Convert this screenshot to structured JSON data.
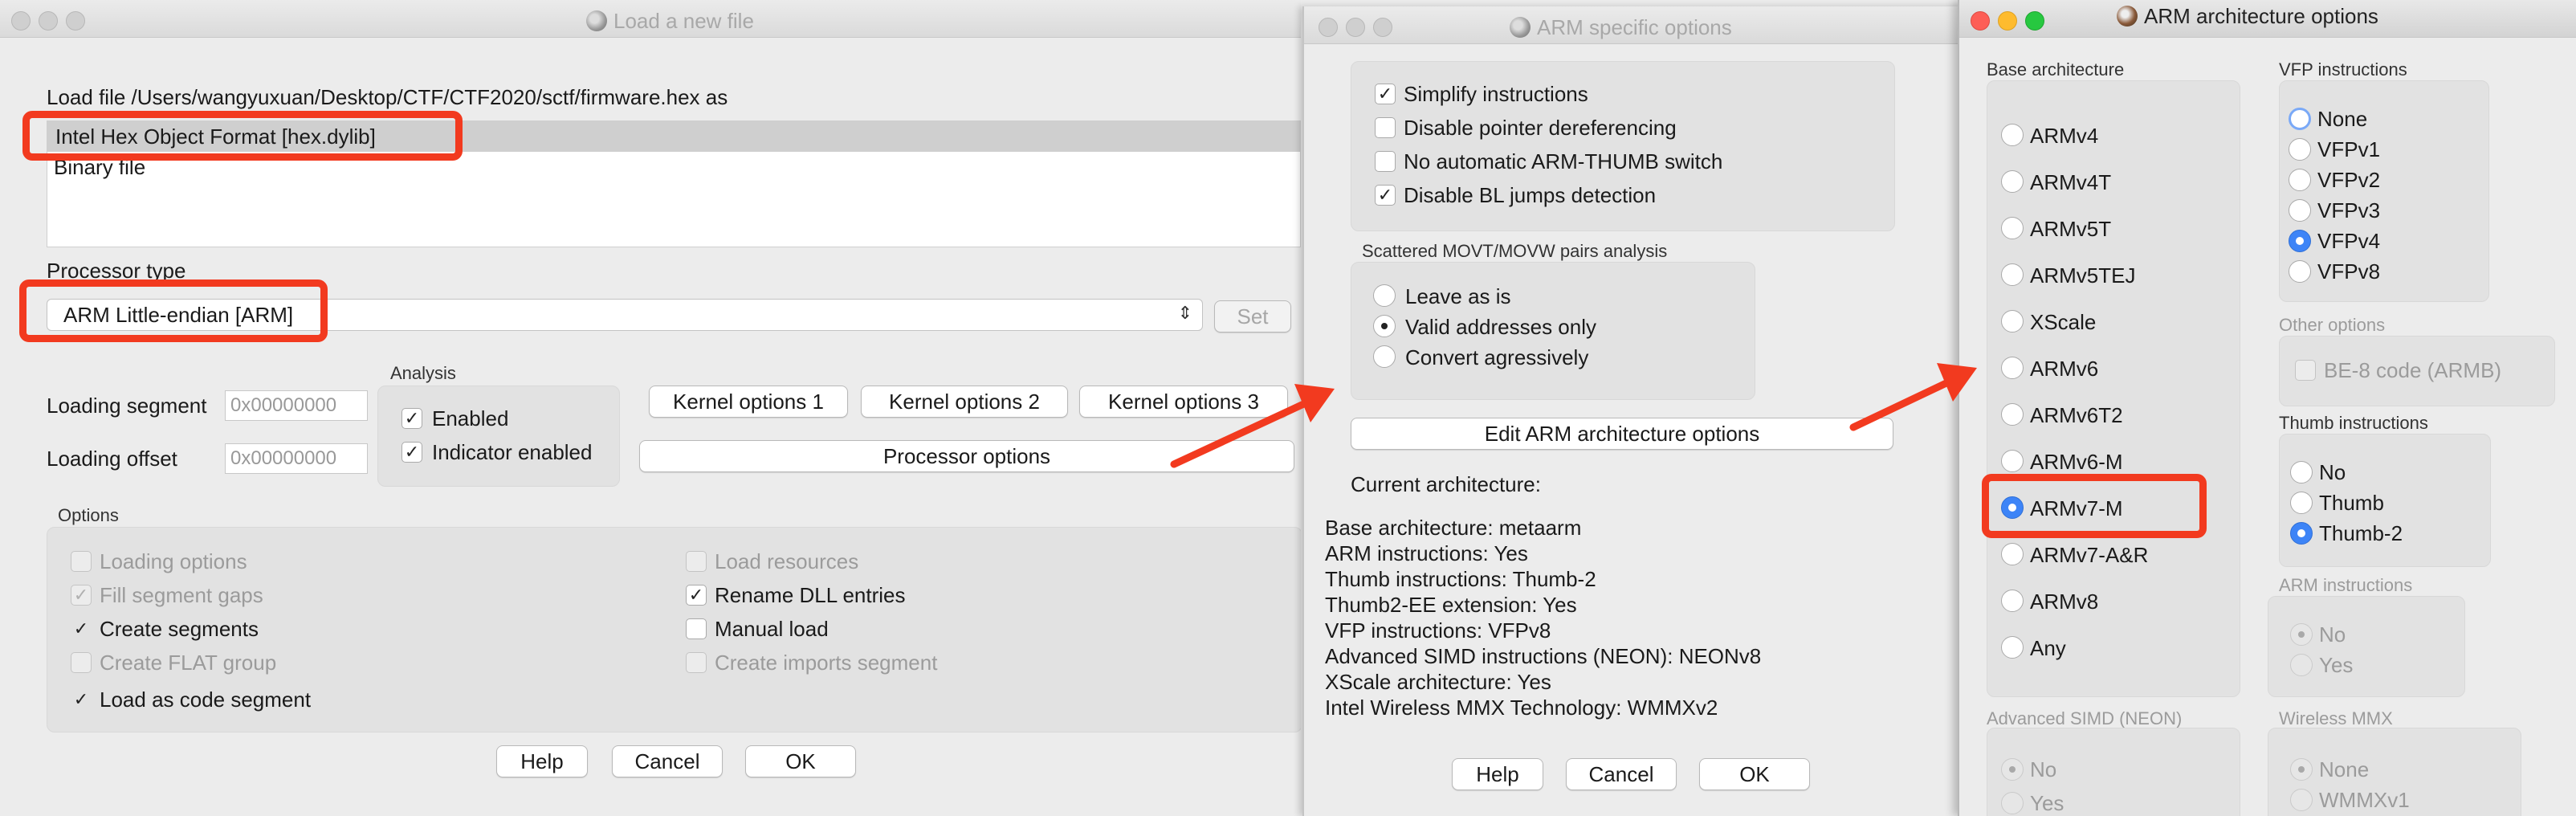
{
  "load_window": {
    "title": "Load a new file",
    "load_file_label": "Load file /Users/wangyuxuan/Desktop/CTF/CTF2020/sctf/firmware.hex as",
    "formats": [
      "Intel Hex Object Format [hex.dylib]",
      "Binary file"
    ],
    "processor_type_label": "Processor type",
    "processor_value": "ARM Little-endian [ARM]",
    "set_button": "Set",
    "analysis_label": "Analysis",
    "enabled_label": "Enabled",
    "indicator_label": "Indicator enabled",
    "loading_segment_label": "Loading segment",
    "loading_segment_value": "0x00000000",
    "loading_offset_label": "Loading offset",
    "loading_offset_value": "0x00000000",
    "kernel_options_1": "Kernel options 1",
    "kernel_options_2": "Kernel options 2",
    "kernel_options_3": "Kernel options 3",
    "processor_options": "Processor options",
    "options_label": "Options",
    "opt_loading_options": "Loading options",
    "opt_fill_segment_gaps": "Fill segment gaps",
    "opt_create_segments": "Create segments",
    "opt_create_flat_group": "Create FLAT group",
    "opt_load_as_code": "Load as code segment",
    "opt_load_resources": "Load resources",
    "opt_rename_dll": "Rename DLL entries",
    "opt_manual_load": "Manual load",
    "opt_create_imports": "Create imports segment",
    "help": "Help",
    "cancel": "Cancel",
    "ok": "OK"
  },
  "arm_specific": {
    "title": "ARM specific options",
    "simplify": "Simplify instructions",
    "disable_ptr": "Disable pointer dereferencing",
    "no_auto_switch": "No automatic ARM-THUMB switch",
    "disable_bl": "Disable BL jumps detection",
    "scattered_label": "Scattered MOVT/MOVW pairs analysis",
    "leave_as_is": "Leave as is",
    "valid_only": "Valid addresses only",
    "convert_aggr": "Convert agressively",
    "edit_arch_button": "Edit ARM architecture options",
    "current_arch_label": "Current architecture:",
    "arch_lines": [
      "Base architecture: metaarm",
      "ARM instructions: Yes",
      "Thumb instructions: Thumb-2",
      "Thumb2-EE extension: Yes",
      "VFP instructions: VFPv8",
      "Advanced SIMD instructions (NEON): NEONv8",
      "XScale architecture: Yes",
      "Intel Wireless MMX Technology: WMMXv2"
    ],
    "help": "Help",
    "cancel": "Cancel",
    "ok": "OK"
  },
  "arm_arch": {
    "title": "ARM architecture options",
    "base_label": "Base architecture",
    "base_items": [
      "ARMv4",
      "ARMv4T",
      "ARMv5T",
      "ARMv5TEJ",
      "XScale",
      "ARMv6",
      "ARMv6T2",
      "ARMv6-M",
      "ARMv7-M",
      "ARMv7-A&R",
      "ARMv8",
      "Any"
    ],
    "base_selected": "ARMv7-M",
    "vfp_label": "VFP instructions",
    "vfp_items": [
      "None",
      "VFPv1",
      "VFPv2",
      "VFPv3",
      "VFPv4",
      "VFPv8"
    ],
    "vfp_selected": "VFPv4",
    "other_label": "Other options",
    "be8": "BE-8 code (ARMB)",
    "thumb_label": "Thumb instructions",
    "thumb_items": [
      "No",
      "Thumb",
      "Thumb-2"
    ],
    "thumb_selected": "Thumb-2",
    "arm_instr_label": "ARM instructions",
    "arm_items": [
      "No",
      "Yes"
    ],
    "simd_label": "Advanced SIMD (NEON)",
    "simd_items": [
      "No",
      "Yes"
    ],
    "wmmx_label": "Wireless MMX",
    "wmmx_items": [
      "None",
      "WMMXv1"
    ]
  },
  "colors": {
    "accent_blue": "#3d84f7",
    "highlight_red": "#f23a1f",
    "arrow_red": "#f23a1f"
  }
}
